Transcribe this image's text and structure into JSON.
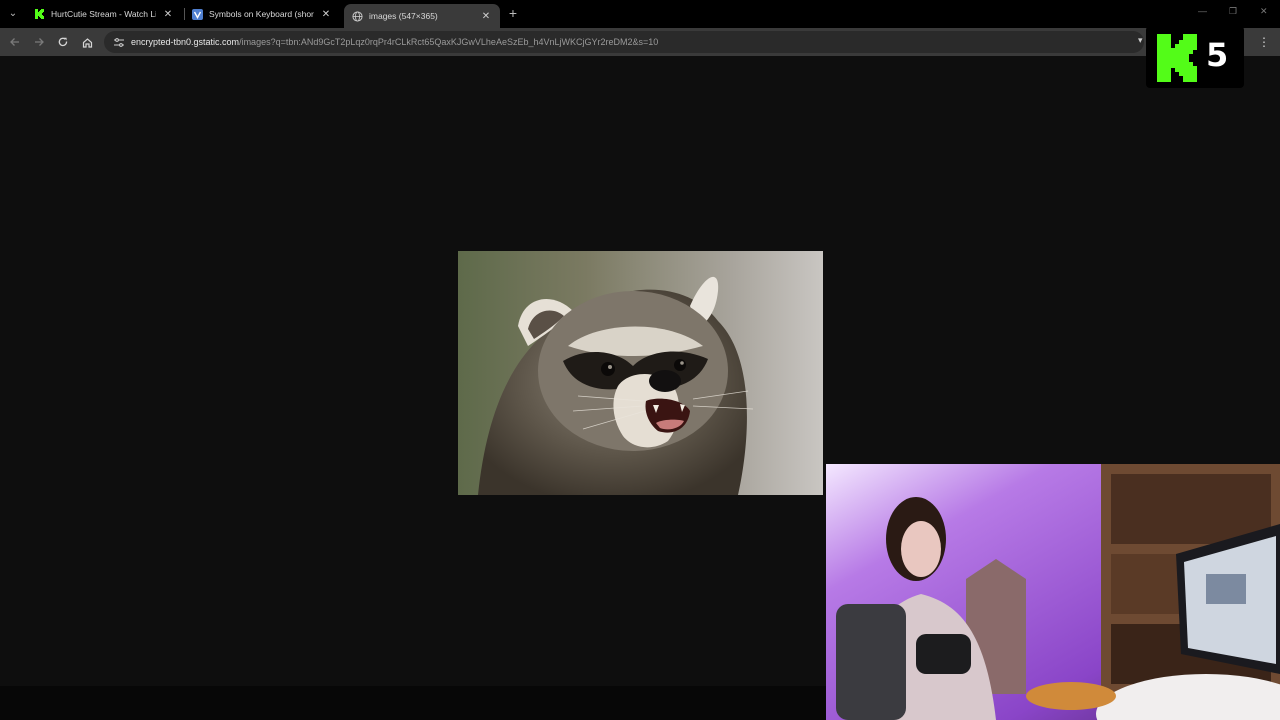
{
  "browser": {
    "tabs": [
      {
        "title": "HurtCutie Stream - Watch Live",
        "favicon": "kick-icon",
        "active": false
      },
      {
        "title": "Symbols on Keyboard (shortcut",
        "favicon": "v-icon",
        "active": false
      },
      {
        "title": "images (547×365)",
        "favicon": "globe-icon",
        "active": true
      }
    ],
    "url": {
      "host": "encrypted-tbn0.gstatic.com",
      "path": "/images?q=tbn:ANd9GcT2pLqz0rqPr4rCLkRct65QaxKJGwVLheAeSzEb_h4VnLjWKCjGYr2reDM2&s=10"
    }
  },
  "content": {
    "image_alt": "raccoon"
  },
  "overlay": {
    "badge_number": "5",
    "brand_color": "#53fc18"
  },
  "webcam": {
    "label": "streamer webcam"
  }
}
